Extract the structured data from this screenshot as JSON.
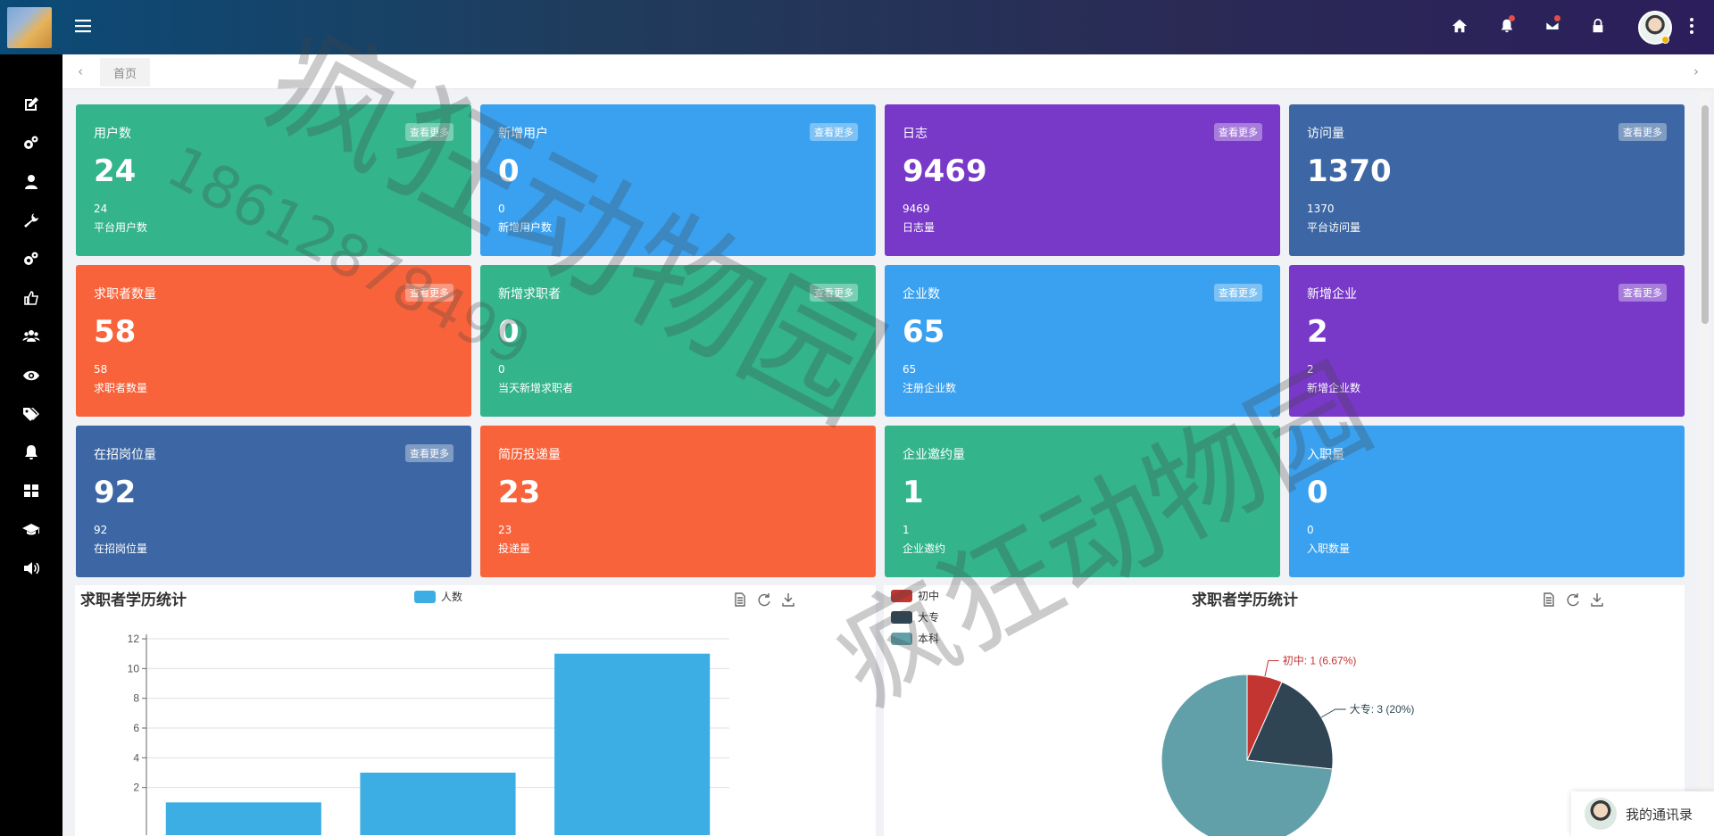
{
  "colors": {
    "green": "#33b48b",
    "blue": "#3aa1f0",
    "purple": "#7838c8",
    "navy": "#3c67a4",
    "orange": "#f8633b",
    "bar": "#3daee3",
    "pie_chuzhong": "#c23531",
    "pie_dazhuan": "#2f4554",
    "pie_benke": "#61a0a8"
  },
  "header": {
    "icons": [
      "menu-icon",
      "home-icon",
      "bell-icon",
      "mail-icon",
      "lock-icon",
      "avatar",
      "more-vertical-icon"
    ]
  },
  "tabs": {
    "home": "首页",
    "prev": "‹",
    "next": "›"
  },
  "sidebar_icons": [
    "edit-icon",
    "gears-icon",
    "user-icon",
    "wrench-icon",
    "gears-icon",
    "thumbs-up-icon",
    "users-icon",
    "eye-icon",
    "tags-icon",
    "bell-icon",
    "grid-icon",
    "graduation-cap-icon",
    "volume-icon"
  ],
  "cards": [
    {
      "title": "用户数",
      "value": "24",
      "sub": "24",
      "label": "平台用户数",
      "more": "查看更多",
      "color": "green"
    },
    {
      "title": "新增用户",
      "value": "0",
      "sub": "0",
      "label": "新增用户数",
      "more": "查看更多",
      "color": "blue"
    },
    {
      "title": "日志",
      "value": "9469",
      "sub": "9469",
      "label": "日志量",
      "more": "查看更多",
      "color": "purple"
    },
    {
      "title": "访问量",
      "value": "1370",
      "sub": "1370",
      "label": "平台访问量",
      "more": "查看更多",
      "color": "navy"
    },
    {
      "title": "求职者数量",
      "value": "58",
      "sub": "58",
      "label": "求职者数量",
      "more": "查看更多",
      "color": "orange"
    },
    {
      "title": "新增求职者",
      "value": "0",
      "sub": "0",
      "label": "当天新增求职者",
      "more": "查看更多",
      "color": "green"
    },
    {
      "title": "企业数",
      "value": "65",
      "sub": "65",
      "label": "注册企业数",
      "more": "查看更多",
      "color": "blue"
    },
    {
      "title": "新增企业",
      "value": "2",
      "sub": "2",
      "label": "新增企业数",
      "more": "查看更多",
      "color": "purple"
    },
    {
      "title": "在招岗位量",
      "value": "92",
      "sub": "92",
      "label": "在招岗位量",
      "more": "查看更多",
      "color": "navy"
    },
    {
      "title": "简历投递量",
      "value": "23",
      "sub": "23",
      "label": "投递量",
      "more": "",
      "color": "orange"
    },
    {
      "title": "企业邀约量",
      "value": "1",
      "sub": "1",
      "label": "企业邀约",
      "more": "",
      "color": "green"
    },
    {
      "title": "入职量",
      "value": "0",
      "sub": "0",
      "label": "入职数量",
      "more": "",
      "color": "blue"
    }
  ],
  "chart_data": [
    {
      "type": "bar",
      "title": "求职者学历统计",
      "series": [
        {
          "name": "人数",
          "values": [
            1,
            3,
            11
          ]
        }
      ],
      "ylim": [
        0,
        12
      ],
      "yticks": [
        2,
        4,
        6,
        8,
        10,
        12
      ],
      "grid": true,
      "legend_position": "top-center"
    },
    {
      "type": "pie",
      "title": "求职者学历统计",
      "slices": [
        {
          "name": "初中",
          "value": 1,
          "label": "初中: 1 (6.67%)"
        },
        {
          "name": "大专",
          "value": 3,
          "label": "大专: 3 (20%)"
        },
        {
          "name": "本科",
          "value": 11
        }
      ],
      "legend_position": "top-left"
    }
  ],
  "contacts": {
    "label": "我的通讯录"
  },
  "watermark": {
    "text": "疯狂动物园",
    "phone": "18612878499"
  }
}
